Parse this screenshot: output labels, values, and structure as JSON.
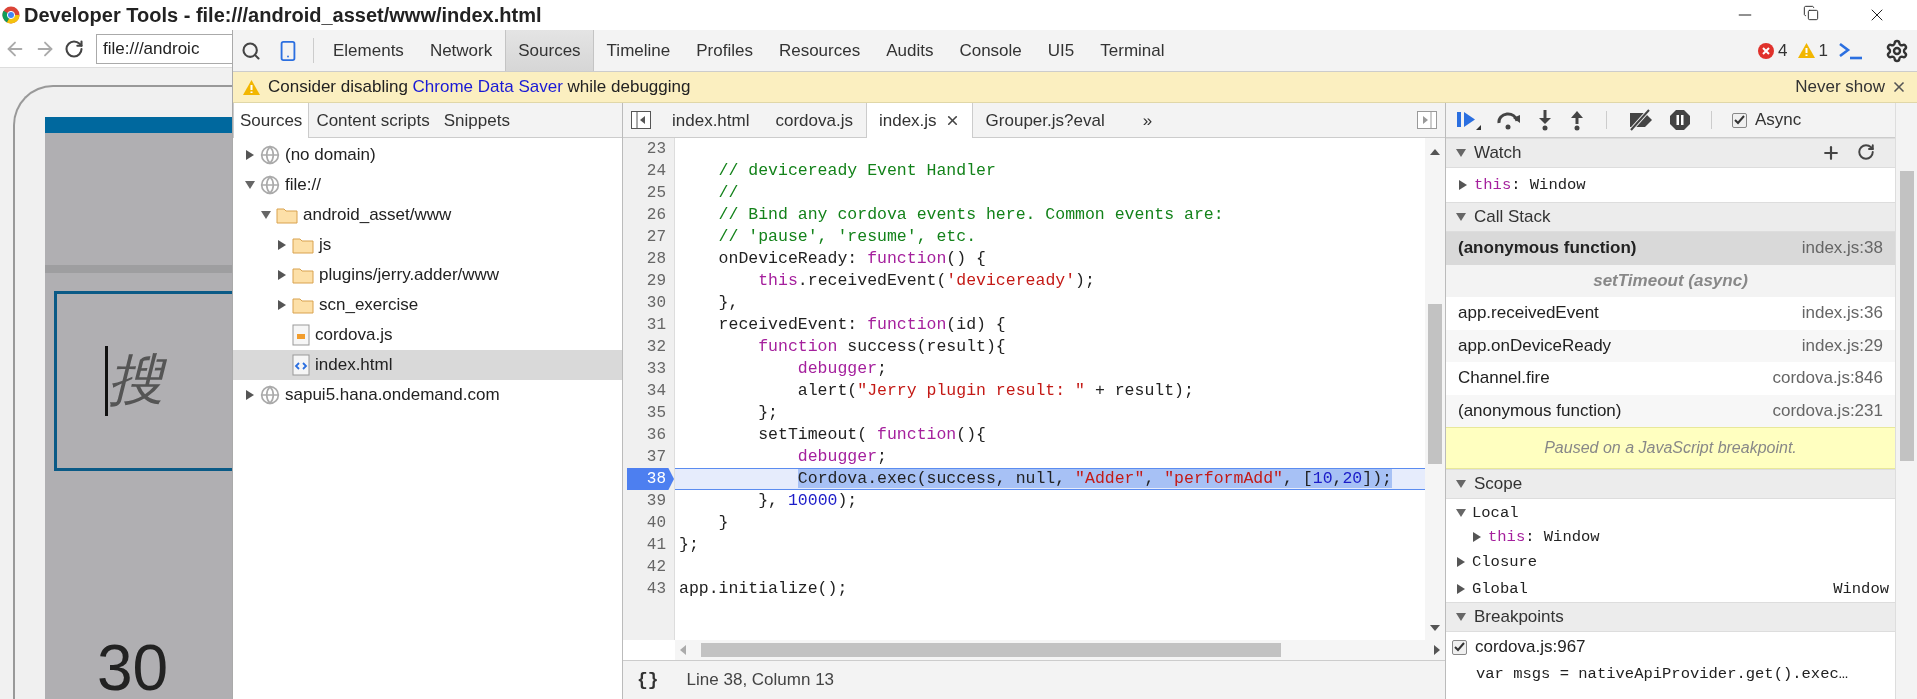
{
  "window": {
    "title": "Developer Tools - file:///android_asset/www/index.html"
  },
  "browser": {
    "url": "file:///androic",
    "search_text": "搜",
    "number_text": "30"
  },
  "toolbar": {
    "tabs": [
      {
        "label": "Elements",
        "selected": false
      },
      {
        "label": "Network",
        "selected": false
      },
      {
        "label": "Sources",
        "selected": true
      },
      {
        "label": "Timeline",
        "selected": false
      },
      {
        "label": "Profiles",
        "selected": false
      },
      {
        "label": "Resources",
        "selected": false
      },
      {
        "label": "Audits",
        "selected": false
      },
      {
        "label": "Console",
        "selected": false
      },
      {
        "label": "UI5",
        "selected": false
      },
      {
        "label": "Terminal",
        "selected": false
      }
    ],
    "error_count": "4",
    "warning_count": "1"
  },
  "notice": {
    "before": "Consider disabling ",
    "link": "Chrome Data Saver",
    "after": " while debugging",
    "dismiss": "Never show"
  },
  "navigator": {
    "tabs": [
      {
        "label": "Sources",
        "selected": true
      },
      {
        "label": "Content scripts",
        "selected": false
      },
      {
        "label": "Snippets",
        "selected": false
      }
    ],
    "tree": [
      {
        "kind": "domain",
        "label": "(no domain)",
        "expanded": false,
        "selected": false
      },
      {
        "kind": "domain",
        "label": "file://",
        "expanded": true,
        "selected": false,
        "children": [
          {
            "kind": "folder",
            "label": "android_asset/www",
            "expanded": true,
            "selected": false,
            "children": [
              {
                "kind": "folder",
                "label": "js",
                "expanded": false,
                "selected": false
              },
              {
                "kind": "folder",
                "label": "plugins/jerry.adder/www",
                "expanded": false,
                "selected": false
              },
              {
                "kind": "folder",
                "label": "scn_exercise",
                "expanded": false,
                "selected": false
              },
              {
                "kind": "script",
                "label": "cordova.js",
                "selected": false
              },
              {
                "kind": "page",
                "label": "index.html",
                "selected": true
              }
            ]
          }
        ]
      },
      {
        "kind": "domain",
        "label": "sapui5.hana.ondemand.com",
        "expanded": false,
        "selected": false
      }
    ]
  },
  "editor": {
    "tabs": [
      {
        "label": "index.html",
        "selected": false,
        "closable": false
      },
      {
        "label": "cordova.js",
        "selected": false,
        "closable": false
      },
      {
        "label": "index.js",
        "selected": true,
        "closable": true
      },
      {
        "label": "Grouper.js?eval",
        "selected": false,
        "closable": false
      }
    ],
    "more": "»",
    "lines": [
      {
        "number": "23",
        "current": false
      },
      {
        "number": "24",
        "current": false,
        "tokens": [
          {
            "kind": "comment",
            "text": "    // deviceready Event Handler"
          }
        ]
      },
      {
        "number": "25",
        "current": false,
        "tokens": [
          {
            "kind": "comment",
            "text": "    //"
          }
        ]
      },
      {
        "number": "26",
        "current": false,
        "tokens": [
          {
            "kind": "comment",
            "text": "    // Bind any cordova events here. Common events are:"
          }
        ]
      },
      {
        "number": "27",
        "current": false,
        "tokens": [
          {
            "kind": "comment",
            "text": "    // 'pause', 'resume', etc."
          }
        ]
      },
      {
        "number": "28",
        "current": false,
        "tokens": [
          {
            "kind": "plain",
            "text": "    onDeviceReady: "
          },
          {
            "kind": "keyword",
            "text": "function"
          },
          {
            "kind": "plain",
            "text": "() {"
          }
        ]
      },
      {
        "number": "29",
        "current": false,
        "tokens": [
          {
            "kind": "keyword",
            "text": "        this"
          },
          {
            "kind": "plain",
            "text": ".receivedEvent("
          },
          {
            "kind": "string",
            "text": "'deviceready'"
          },
          {
            "kind": "plain",
            "text": ");"
          }
        ]
      },
      {
        "number": "30",
        "current": false,
        "tokens": [
          {
            "kind": "plain",
            "text": "    },"
          }
        ]
      },
      {
        "number": "31",
        "current": false,
        "tokens": [
          {
            "kind": "plain",
            "text": "    receivedEvent: "
          },
          {
            "kind": "keyword",
            "text": "function"
          },
          {
            "kind": "plain",
            "text": "(id) {"
          }
        ]
      },
      {
        "number": "32",
        "current": false,
        "tokens": [
          {
            "kind": "keyword",
            "text": "        function"
          },
          {
            "kind": "plain",
            "text": " success(result){"
          }
        ]
      },
      {
        "number": "33",
        "current": false,
        "tokens": [
          {
            "kind": "keyword",
            "text": "            debugger"
          },
          {
            "kind": "plain",
            "text": ";"
          }
        ]
      },
      {
        "number": "34",
        "current": false,
        "tokens": [
          {
            "kind": "plain",
            "text": "            alert("
          },
          {
            "kind": "string",
            "text": "\"Jerry plugin result: \""
          },
          {
            "kind": "plain",
            "text": " + result);"
          }
        ]
      },
      {
        "number": "35",
        "current": false,
        "tokens": [
          {
            "kind": "plain",
            "text": "        };"
          }
        ]
      },
      {
        "number": "36",
        "current": false,
        "tokens": [
          {
            "kind": "plain",
            "text": "        setTimeout( "
          },
          {
            "kind": "keyword",
            "text": "function"
          },
          {
            "kind": "plain",
            "text": "(){"
          }
        ]
      },
      {
        "number": "37",
        "current": false,
        "tokens": [
          {
            "kind": "keyword",
            "text": "            debugger"
          },
          {
            "kind": "plain",
            "text": ";"
          }
        ]
      },
      {
        "number": "38",
        "current": true,
        "tokens": [
          {
            "kind": "plain",
            "text": "            Cordova.exec(success, null, "
          },
          {
            "kind": "string",
            "text": "\"Adder\""
          },
          {
            "kind": "plain",
            "text": ", "
          },
          {
            "kind": "string",
            "text": "\"performAdd\""
          },
          {
            "kind": "plain",
            "text": ", ["
          },
          {
            "kind": "number",
            "text": "10"
          },
          {
            "kind": "plain",
            "text": ","
          },
          {
            "kind": "number",
            "text": "20"
          },
          {
            "kind": "plain",
            "text": "]);"
          }
        ]
      },
      {
        "number": "39",
        "current": false,
        "tokens": [
          {
            "kind": "plain",
            "text": "        }, "
          },
          {
            "kind": "number",
            "text": "10000"
          },
          {
            "kind": "plain",
            "text": ");"
          }
        ]
      },
      {
        "number": "40",
        "current": false,
        "tokens": [
          {
            "kind": "plain",
            "text": "    }"
          }
        ]
      },
      {
        "number": "41",
        "current": false,
        "tokens": [
          {
            "kind": "plain",
            "text": "};"
          }
        ]
      },
      {
        "number": "42",
        "current": false
      },
      {
        "number": "43",
        "current": false,
        "tokens": [
          {
            "kind": "plain",
            "text": "app.initialize();"
          }
        ]
      }
    ],
    "format_button": "{}",
    "status": "Line 38, Column 13"
  },
  "debugger": {
    "async": {
      "label": "Async",
      "checked": true
    },
    "watch": {
      "title": "Watch",
      "expanded": true,
      "entries": [
        {
          "expanded": false,
          "tokens": [
            {
              "kind": "keyword",
              "text": "this"
            },
            {
              "kind": "plain",
              "text": ": Window"
            }
          ]
        }
      ]
    },
    "call_stack": {
      "title": "Call Stack",
      "expanded": true,
      "frames": [
        {
          "kind": "frame",
          "name": "(anonymous function)",
          "location": "index.js:38",
          "selected": true
        },
        {
          "kind": "async",
          "name": "setTimeout (async)"
        },
        {
          "kind": "frame",
          "name": "app.receivedEvent",
          "location": "index.js:36",
          "selected": false
        },
        {
          "kind": "frame",
          "name": "app.onDeviceReady",
          "location": "index.js:29",
          "selected": false
        },
        {
          "kind": "frame",
          "name": "Channel.fire",
          "location": "cordova.js:846",
          "selected": false
        },
        {
          "kind": "frame",
          "name": "(anonymous function)",
          "location": "cordova.js:231",
          "selected": false
        }
      ]
    },
    "paused_message": "Paused on a JavaScript breakpoint.",
    "scope": {
      "title": "Scope",
      "expanded": true,
      "entries": [
        {
          "label": "Local",
          "expanded": true,
          "children": [
            {
              "expanded": false,
              "tokens": [
                {
                  "kind": "keyword",
                  "text": "this"
                },
                {
                  "kind": "plain",
                  "text": ": Window"
                }
              ]
            }
          ]
        },
        {
          "label": "Closure",
          "expanded": false
        },
        {
          "label": "Global",
          "expanded": false,
          "value": "Window"
        }
      ]
    },
    "breakpoints": {
      "title": "Breakpoints",
      "expanded": true,
      "items": [
        {
          "label": "cordova.js:967",
          "checked": true,
          "code": "var msgs = nativeApiProvider.get().exec…"
        }
      ]
    }
  }
}
